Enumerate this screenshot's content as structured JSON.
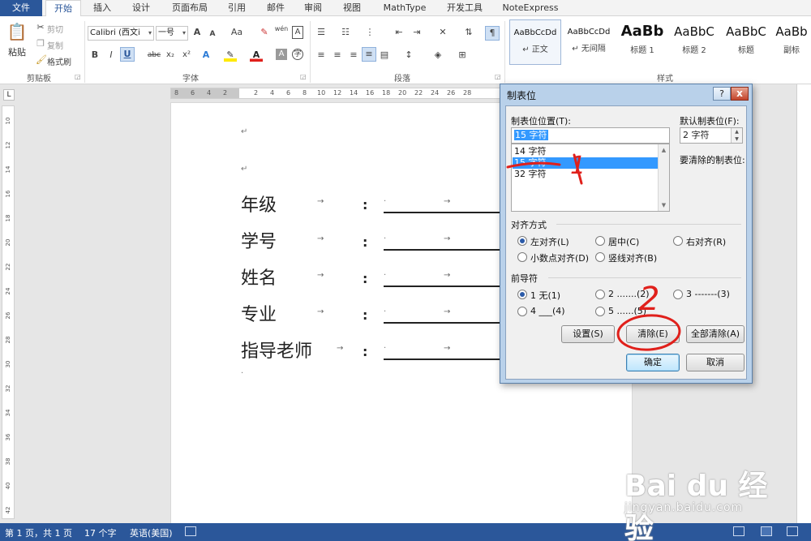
{
  "tabs": [
    "文件",
    "开始",
    "插入",
    "设计",
    "页面布局",
    "引用",
    "邮件",
    "审阅",
    "视图",
    "MathType",
    "开发工具",
    "NoteExpress"
  ],
  "active_tab_index": 1,
  "ribbon": {
    "clipboard": {
      "paste": "粘贴",
      "cut": "剪切",
      "copy": "复制",
      "format_painter": "格式刷",
      "label": "剪贴板"
    },
    "font": {
      "font_name": "Calibri (西文i",
      "font_size": "一号",
      "grow": "A",
      "shrink": "A",
      "case": "Aa",
      "phonetic": "wén",
      "border_char": "A",
      "bold": "B",
      "italic": "I",
      "underline": "U",
      "strike": "abc",
      "sub": "x₂",
      "sup": "x²",
      "label": "字体"
    },
    "paragraph": {
      "label": "段落"
    },
    "styles": {
      "label": "样式",
      "items": [
        {
          "sample": "AaBbCcDd",
          "name": "↵ 正文"
        },
        {
          "sample": "AaBbCcDd",
          "name": "↵ 无间隔"
        },
        {
          "sample": "AaBb",
          "name": "标题 1"
        },
        {
          "sample": "AaBbC",
          "name": "标题 2"
        },
        {
          "sample": "AaBbC",
          "name": "标题"
        },
        {
          "sample": "AaBb",
          "name": "副标"
        }
      ],
      "selected_index": 0
    }
  },
  "ruler": {
    "corner": "L",
    "ticks": [
      "8",
      "6",
      "4",
      "2",
      "2",
      "4",
      "6",
      "8",
      "10",
      "12",
      "14",
      "16",
      "18",
      "20",
      "22",
      "24",
      "26",
      "28"
    ]
  },
  "vruler_ticks": [
    "10",
    "12",
    "14",
    "16",
    "18",
    "20",
    "22",
    "24",
    "26",
    "28",
    "30",
    "32",
    "34",
    "36",
    "38",
    "40",
    "42"
  ],
  "document": {
    "para_mark": "↵",
    "tab_arrow": "→",
    "colon": ":",
    "dot": "·",
    "rows": [
      "年级",
      "学号",
      "姓名",
      "专业",
      "指导老师"
    ]
  },
  "dialog": {
    "title": "制表位",
    "help": "?",
    "close": "x",
    "tab_pos_label": "制表位位置(T):",
    "tab_pos_value": "15 字符",
    "list_items": [
      "14 字符",
      "15 字符",
      "32 字符"
    ],
    "list_selected_index": 1,
    "default_tab_label": "默认制表位(F):",
    "default_tab_value": "2 字符",
    "to_clear_label": "要清除的制表位:",
    "alignment_label": "对齐方式",
    "alignment_options": [
      "左对齐(L)",
      "居中(C)",
      "右对齐(R)",
      "小数点对齐(D)",
      "竖线对齐(B)"
    ],
    "alignment_selected_index": 0,
    "leader_label": "前导符",
    "leader_options": [
      "1 无(1)",
      "2 .......(2)",
      "3 -------(3)",
      "4 ___(4)",
      "5 ......(5)"
    ],
    "leader_selected_index": 0,
    "btn_set": "设置(S)",
    "btn_clear": "清除(E)",
    "btn_clear_all": "全部清除(A)",
    "btn_ok": "确定",
    "btn_cancel": "取消"
  },
  "annotations": {
    "mark1": "1",
    "mark2": "2"
  },
  "status": {
    "page": "第 1 页，共 1 页",
    "words": "17 个字",
    "lang": "英语(美国)"
  },
  "watermark": {
    "logo": "Bai du 经验",
    "site": "jingyan.baidu.com"
  },
  "colors": {
    "word_blue": "#2b579a",
    "selection": "#3399ff",
    "annotation_red": "#e0201b"
  }
}
